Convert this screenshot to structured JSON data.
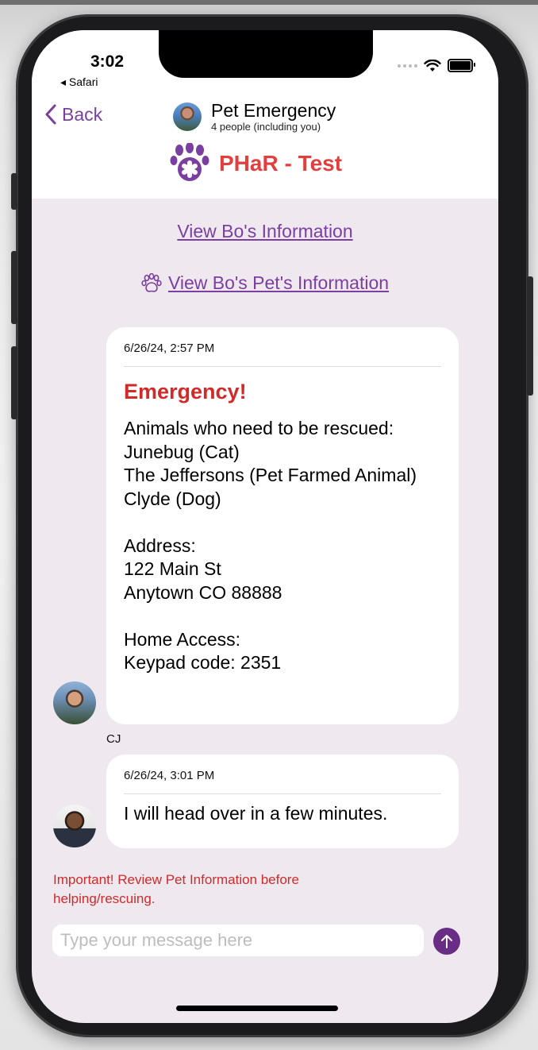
{
  "status_bar": {
    "time": "3:02",
    "back_app": "◂ Safari"
  },
  "nav": {
    "back_label": "Back"
  },
  "chat": {
    "title": "Pet Emergency",
    "subtitle": "4 people (including you)"
  },
  "brand": {
    "name": "PHaR - Test"
  },
  "links": {
    "owner_info": "View Bo's Information",
    "pet_info": "View Bo's Pet's Information"
  },
  "messages": [
    {
      "timestamp": "6/26/24, 2:57 PM",
      "heading": "Emergency!",
      "lines": [
        "Animals who need to be rescued:",
        "Junebug (Cat)",
        "The Jeffersons (Pet Farmed Animal)",
        "Clyde (Dog)",
        "",
        "Address:",
        "122 Main St",
        "Anytown CO 88888",
        "",
        "Home Access:",
        "Keypad code: 2351"
      ],
      "sender": "CJ"
    },
    {
      "timestamp": "6/26/24, 3:01 PM",
      "text": "I will head over in a few minutes."
    }
  ],
  "warning": "Important! Review Pet Information before helping/rescuing.",
  "composer": {
    "placeholder": "Type your message here"
  },
  "icons": {
    "back": "chevron-left-icon",
    "brand": "paw-icon",
    "pet_link": "paw-outline-icon",
    "send": "arrow-up-icon",
    "wifi": "wifi-icon",
    "battery": "battery-icon"
  },
  "colors": {
    "accent": "#7b3fa0",
    "brand_red": "#e2403f",
    "alert_red": "#d02a2a",
    "send": "#6a2d86",
    "background": "#efe9ef"
  }
}
